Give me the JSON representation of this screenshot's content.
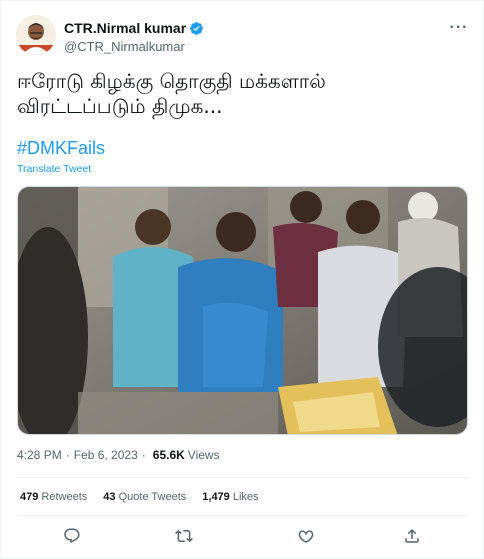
{
  "author": {
    "display_name": "CTR.Nirmal kumar",
    "handle": "@CTR_Nirmalkumar",
    "verified_icon": "verified-badge-icon",
    "more_icon": "more-options-icon"
  },
  "tweet": {
    "text_line1": "ஈரோடு கிழக்கு தொகுதி மக்களால்",
    "text_line2": "விரட்டப்படும் திமுக...",
    "hashtag": "#DMKFails",
    "translate_label": "Translate Tweet",
    "media_description_icon": "video-thumbnail"
  },
  "meta": {
    "time": "4:28 PM",
    "separator": "·",
    "date": "Feb 6, 2023",
    "views_count": "65.6K",
    "views_label": "Views"
  },
  "stats": {
    "retweets_count": "479",
    "retweets_label": "Retweets",
    "quotes_count": "43",
    "quotes_label": "Quote Tweets",
    "likes_count": "1,479",
    "likes_label": "Likes"
  },
  "actions": {
    "reply_icon": "reply-icon",
    "retweet_icon": "retweet-icon",
    "like_icon": "heart-icon",
    "share_icon": "share-icon"
  },
  "colors": {
    "accent": "#1d9bf0",
    "text": "#0f1419",
    "secondary": "#536471",
    "border": "#eff3f4"
  }
}
